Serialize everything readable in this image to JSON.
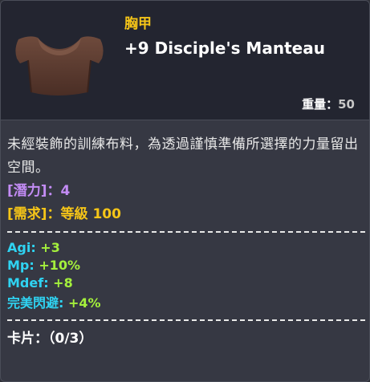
{
  "item": {
    "category": "胸甲",
    "name": "+9 Disciple's Manteau",
    "weight_label": "重量：",
    "weight_value": "50",
    "image_icon": "manteau-icon",
    "description": "未經裝飾的訓練布料，為透過謹慎準備所選擇的力量留出空間。"
  },
  "potential": {
    "label": "[潛力]",
    "value": "：4"
  },
  "requirement": {
    "label": "[需求]",
    "value": "：等級 100"
  },
  "stats": [
    {
      "name": "Agi:",
      "value": " +3"
    },
    {
      "name": "Mp:",
      "value": " +10%"
    },
    {
      "name": "Mdef:",
      "value": " +8"
    },
    {
      "name": "完美閃避:",
      "value": " +4%"
    }
  ],
  "cards": {
    "label": "卡片：",
    "value": "（0/3）"
  },
  "colors": {
    "category": "#f5c518",
    "potential": "#c38cf5",
    "requirement": "#f5c518",
    "stat_name": "#2fd3f2",
    "stat_value": "#a4f03c"
  }
}
